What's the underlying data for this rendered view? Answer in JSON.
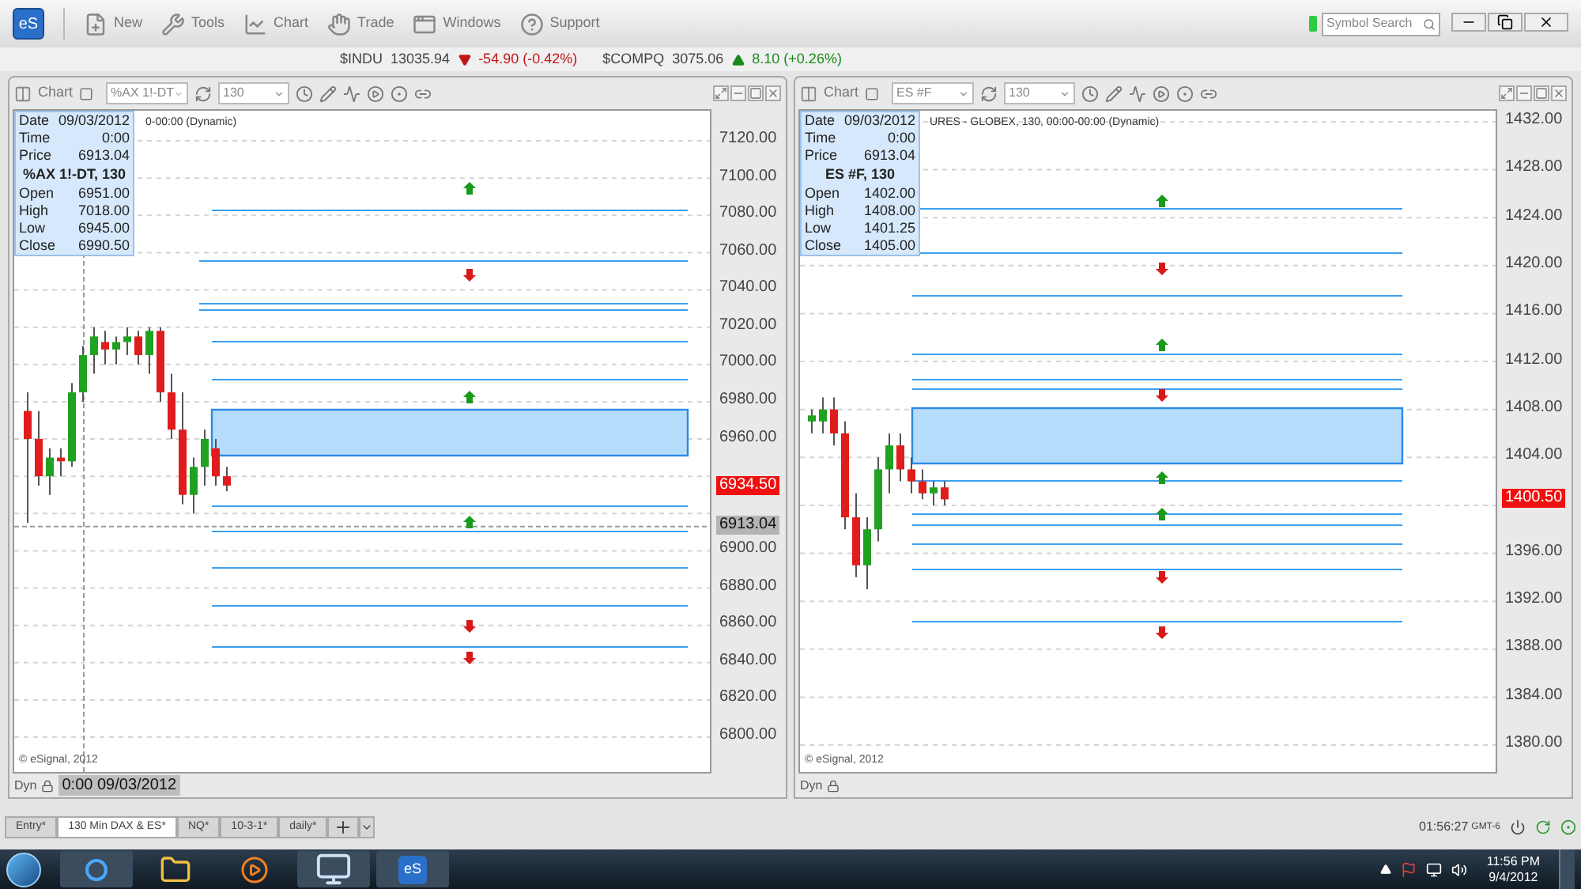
{
  "toolbar": {
    "logo": "eS",
    "menu": [
      {
        "label": "New"
      },
      {
        "label": "Tools"
      },
      {
        "label": "Chart"
      },
      {
        "label": "Trade"
      },
      {
        "label": "Windows"
      },
      {
        "label": "Support"
      }
    ],
    "search": {
      "placeholder": "Symbol Search"
    }
  },
  "ticker": [
    {
      "symbol": "$INDU",
      "price": "13035.94",
      "change": "-54.90 (-0.42%)",
      "kind": "down"
    },
    {
      "symbol": "$COMPQ",
      "price": "3075.06",
      "change": "8.10 (+0.26%)",
      "kind": "up"
    }
  ],
  "charts": [
    {
      "title": "Chart",
      "symbol": "%AX 1!-DT",
      "interval": "130",
      "caption": "0-00:00 (Dynamic)",
      "info_top": [
        {
          "label": "Date",
          "value": "09/03/2012"
        },
        {
          "label": "Time",
          "value": "0:00"
        },
        {
          "label": "Price",
          "value": "6913.04"
        }
      ],
      "heading": "%AX 1!-DT, 130",
      "info_bottom": [
        {
          "label": "Open",
          "value": "6951.00"
        },
        {
          "label": "High",
          "value": "7018.00"
        },
        {
          "label": "Low",
          "value": "6945.00"
        },
        {
          "label": "Close",
          "value": "6990.50"
        }
      ],
      "axis": [
        "7120.00",
        "7100.00",
        "7080.00",
        "7060.00",
        "7040.00",
        "7020.00",
        "7000.00",
        "6980.00",
        "6960.00",
        "6900.00",
        "6880.00",
        "6860.00",
        "6840.00",
        "6820.00",
        "6800.00"
      ],
      "markers": [
        {
          "value": "6934.50",
          "kind": "last"
        },
        {
          "value": "6913.04",
          "kind": "cursor"
        }
      ],
      "copyright": "© eSignal, 2012",
      "footer_label": "Dyn",
      "cursor_time": "0:00 09/03/2012"
    },
    {
      "title": "Chart",
      "symbol": "ES #F",
      "interval": "130",
      "caption": "URES - GLOBEX, 130, 00:00-00:00 (Dynamic)",
      "info_top": [
        {
          "label": "Date",
          "value": "09/03/2012"
        },
        {
          "label": "Time",
          "value": "0:00"
        },
        {
          "label": "Price",
          "value": "6913.04"
        }
      ],
      "heading": "ES #F, 130",
      "info_bottom": [
        {
          "label": "Open",
          "value": "1402.00"
        },
        {
          "label": "High",
          "value": "1408.00"
        },
        {
          "label": "Low",
          "value": "1401.25"
        },
        {
          "label": "Close",
          "value": "1405.00"
        }
      ],
      "axis": [
        "1432.00",
        "1428.00",
        "1424.00",
        "1420.00",
        "1416.00",
        "1412.00",
        "1408.00",
        "1404.00",
        "1396.00",
        "1392.00",
        "1388.00",
        "1384.00",
        "1380.00"
      ],
      "markers": [
        {
          "value": "1400.50",
          "kind": "last"
        }
      ],
      "copyright": "© eSignal, 2012",
      "footer_label": "Dyn"
    }
  ],
  "tabs": [
    {
      "label": "Entry*",
      "selected": false
    },
    {
      "label": "130 Min DAX & ES*",
      "selected": true
    },
    {
      "label": "NQ*",
      "selected": false
    },
    {
      "label": "10-3-1*",
      "selected": false
    },
    {
      "label": "daily*",
      "selected": false
    }
  ],
  "status": {
    "clock": "01:56:27",
    "timezone": "GMT-6"
  },
  "taskbar": {
    "app_logo": "eS",
    "time": "11:56 PM",
    "date": "9/4/2012"
  }
}
